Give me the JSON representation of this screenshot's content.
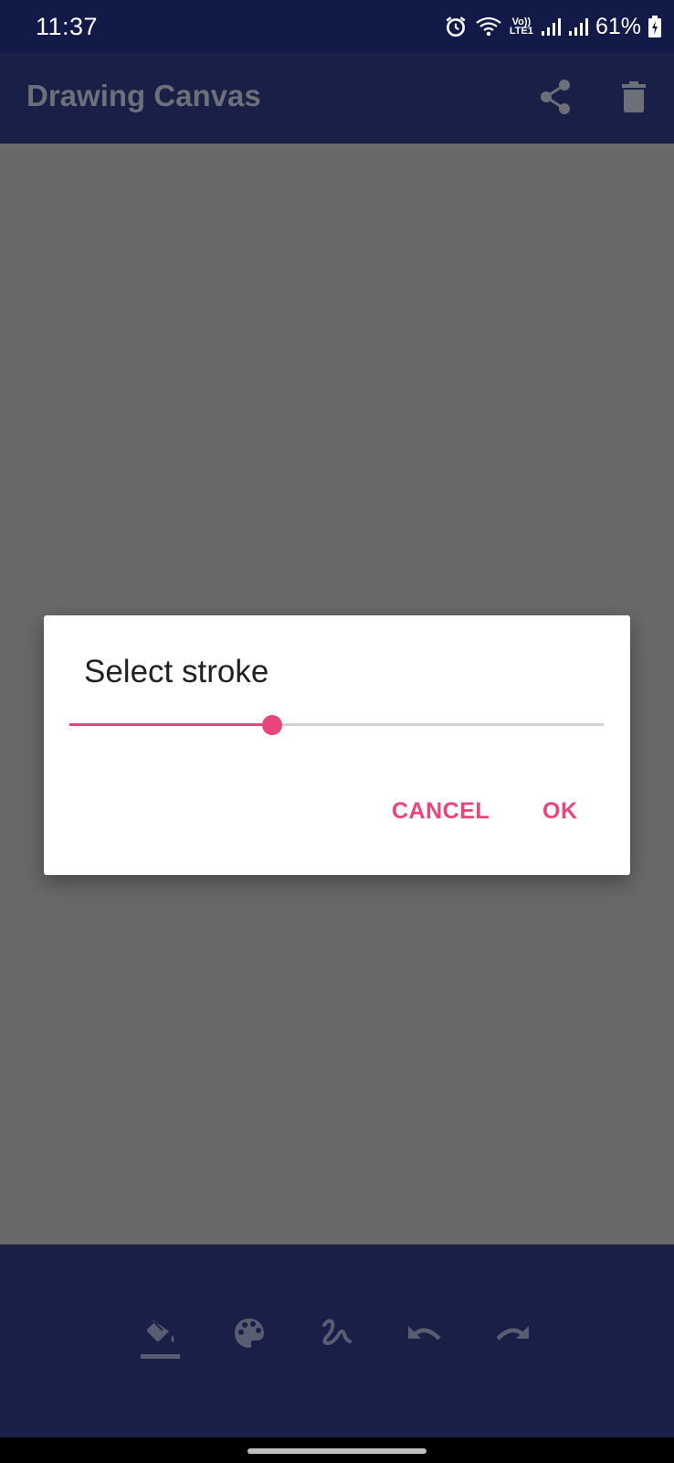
{
  "status_bar": {
    "time": "11:37",
    "network_label_top": "Vo))",
    "network_label_bottom": "LTE1",
    "battery_percent": "61%"
  },
  "app_bar": {
    "title": "Drawing Canvas",
    "actions": [
      {
        "icon": "share-icon"
      },
      {
        "icon": "delete-icon"
      }
    ]
  },
  "dialog": {
    "title": "Select stroke",
    "slider": {
      "value_fraction": 0.38,
      "accent_color": "#e8457a",
      "track_color": "#d0d0d0"
    },
    "cancel_label": "CANCEL",
    "ok_label": "OK"
  },
  "toolbar": {
    "tools": [
      {
        "icon": "fill-bucket-icon",
        "selected": true
      },
      {
        "icon": "palette-icon",
        "selected": false
      },
      {
        "icon": "stroke-icon",
        "selected": false
      },
      {
        "icon": "undo-icon",
        "selected": false
      },
      {
        "icon": "redo-icon",
        "selected": false
      }
    ]
  },
  "colors": {
    "status_bar_bg": "#121a47",
    "app_bar_bg": "#1a1f48",
    "canvas_scrim": "#696969",
    "accent": "#e8457a"
  }
}
